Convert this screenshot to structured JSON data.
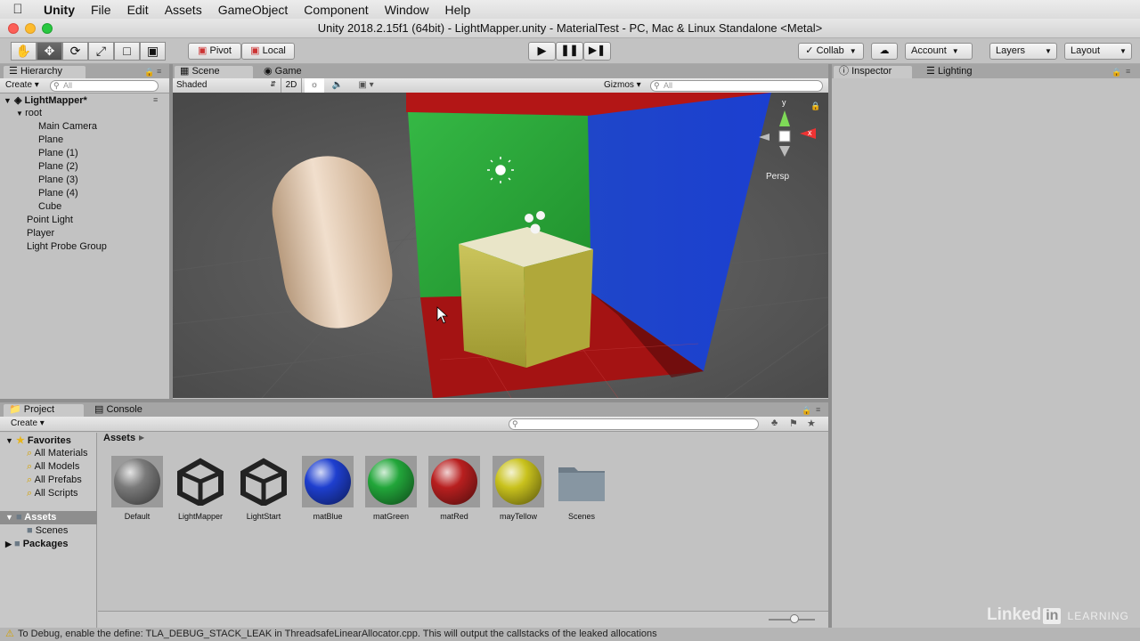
{
  "menubar": {
    "app_name": "Unity",
    "items": [
      "File",
      "Edit",
      "Assets",
      "GameObject",
      "Component",
      "Window",
      "Help"
    ]
  },
  "window": {
    "title": "Unity 2018.2.15f1 (64bit) - LightMapper.unity - MaterialTest - PC, Mac & Linux Standalone <Metal>"
  },
  "toolbar": {
    "pivot_label": "Pivot",
    "local_label": "Local",
    "collab_label": "Collab",
    "account_label": "Account",
    "layers_label": "Layers",
    "layout_label": "Layout"
  },
  "hierarchy": {
    "tab_label": "Hierarchy",
    "create_label": "Create",
    "search_placeholder": "All",
    "scene_name": "LightMapper*",
    "items": [
      {
        "label": "root",
        "level": 1,
        "expanded": true
      },
      {
        "label": "Main Camera",
        "level": 2
      },
      {
        "label": "Plane",
        "level": 2
      },
      {
        "label": "Plane (1)",
        "level": 2
      },
      {
        "label": "Plane (2)",
        "level": 2
      },
      {
        "label": "Plane (3)",
        "level": 2
      },
      {
        "label": "Plane (4)",
        "level": 2
      },
      {
        "label": "Cube",
        "level": 2
      },
      {
        "label": "Point Light",
        "level": 1
      },
      {
        "label": "Player",
        "level": 1
      },
      {
        "label": "Light Probe Group",
        "level": 1
      }
    ]
  },
  "scene": {
    "tab_scene": "Scene",
    "tab_game": "Game",
    "shading_mode": "Shaded",
    "mode_2d": "2D",
    "gizmos_label": "Gizmos",
    "search_placeholder": "All",
    "persp_label": "Persp",
    "axis_y": "y",
    "axis_x": "x"
  },
  "inspector": {
    "tab_inspector": "Inspector",
    "tab_lighting": "Lighting"
  },
  "project": {
    "tab_project": "Project",
    "tab_console": "Console",
    "create_label": "Create",
    "breadcrumb": "Assets",
    "favorites_label": "Favorites",
    "favorites": [
      "All Materials",
      "All Models",
      "All Prefabs",
      "All Scripts"
    ],
    "assets_label": "Assets",
    "assets_children": [
      "Scenes"
    ],
    "packages_label": "Packages",
    "assets": [
      {
        "label": "Default",
        "kind": "material",
        "color": "#7a7a7a"
      },
      {
        "label": "LightMapper",
        "kind": "unity-scene"
      },
      {
        "label": "LightStart",
        "kind": "unity-scene"
      },
      {
        "label": "matBlue",
        "kind": "material",
        "color": "#1e3fcf"
      },
      {
        "label": "matGreen",
        "kind": "material",
        "color": "#22a63a"
      },
      {
        "label": "matRed",
        "kind": "material",
        "color": "#b81f1f"
      },
      {
        "label": "mayTellow",
        "kind": "material",
        "color": "#c9c21d"
      },
      {
        "label": "Scenes",
        "kind": "folder"
      }
    ]
  },
  "statusbar": {
    "message": "To Debug, enable the define: TLA_DEBUG_STACK_LEAK in ThreadsafeLinearAllocator.cpp. This will output the callstacks of the leaked allocations"
  },
  "watermark": {
    "brand": "Linked",
    "brand_in": "in",
    "suffix": "LEARNING"
  },
  "colors": {
    "wall_green": "#2fa63a",
    "wall_blue": "#1f3fcf",
    "floor_red": "#b01818",
    "cube_yellow": "#cfc54a",
    "capsule": "#e6cdb5"
  }
}
